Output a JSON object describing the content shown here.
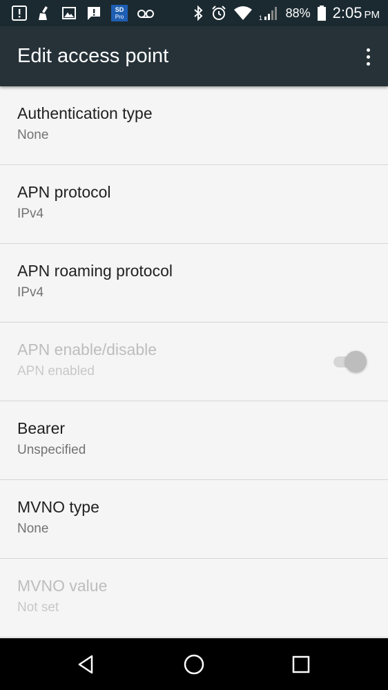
{
  "status_bar": {
    "left_icons": [
      "alert-icon",
      "cleaner-icon",
      "image-icon",
      "message-alert-icon",
      "sd-pro-app-icon",
      "voicemail-icon"
    ],
    "sd_label_top": "SD",
    "sd_label_bottom": "Pro",
    "battery_percent": "88%",
    "time": "2:05",
    "ampm": "PM"
  },
  "app_bar": {
    "title": "Edit access point",
    "overflow_icon": "more-vert-icon"
  },
  "settings": [
    {
      "title": "Authentication type",
      "summary": "None",
      "enabled": true
    },
    {
      "title": "APN protocol",
      "summary": "IPv4",
      "enabled": true
    },
    {
      "title": "APN roaming protocol",
      "summary": "IPv4",
      "enabled": true
    },
    {
      "title": "APN enable/disable",
      "summary": "APN enabled",
      "enabled": false,
      "toggle_on": true
    },
    {
      "title": "Bearer",
      "summary": "Unspecified",
      "enabled": true
    },
    {
      "title": "MVNO type",
      "summary": "None",
      "enabled": true
    },
    {
      "title": "MVNO value",
      "summary": "Not set",
      "enabled": false
    }
  ],
  "nav_bar": {
    "buttons": [
      "back-icon",
      "home-icon",
      "recents-icon"
    ]
  },
  "colors": {
    "status_bar": "#1b2a31",
    "app_bar": "#263238",
    "background": "#f5f5f5",
    "nav_bar": "#000000"
  }
}
